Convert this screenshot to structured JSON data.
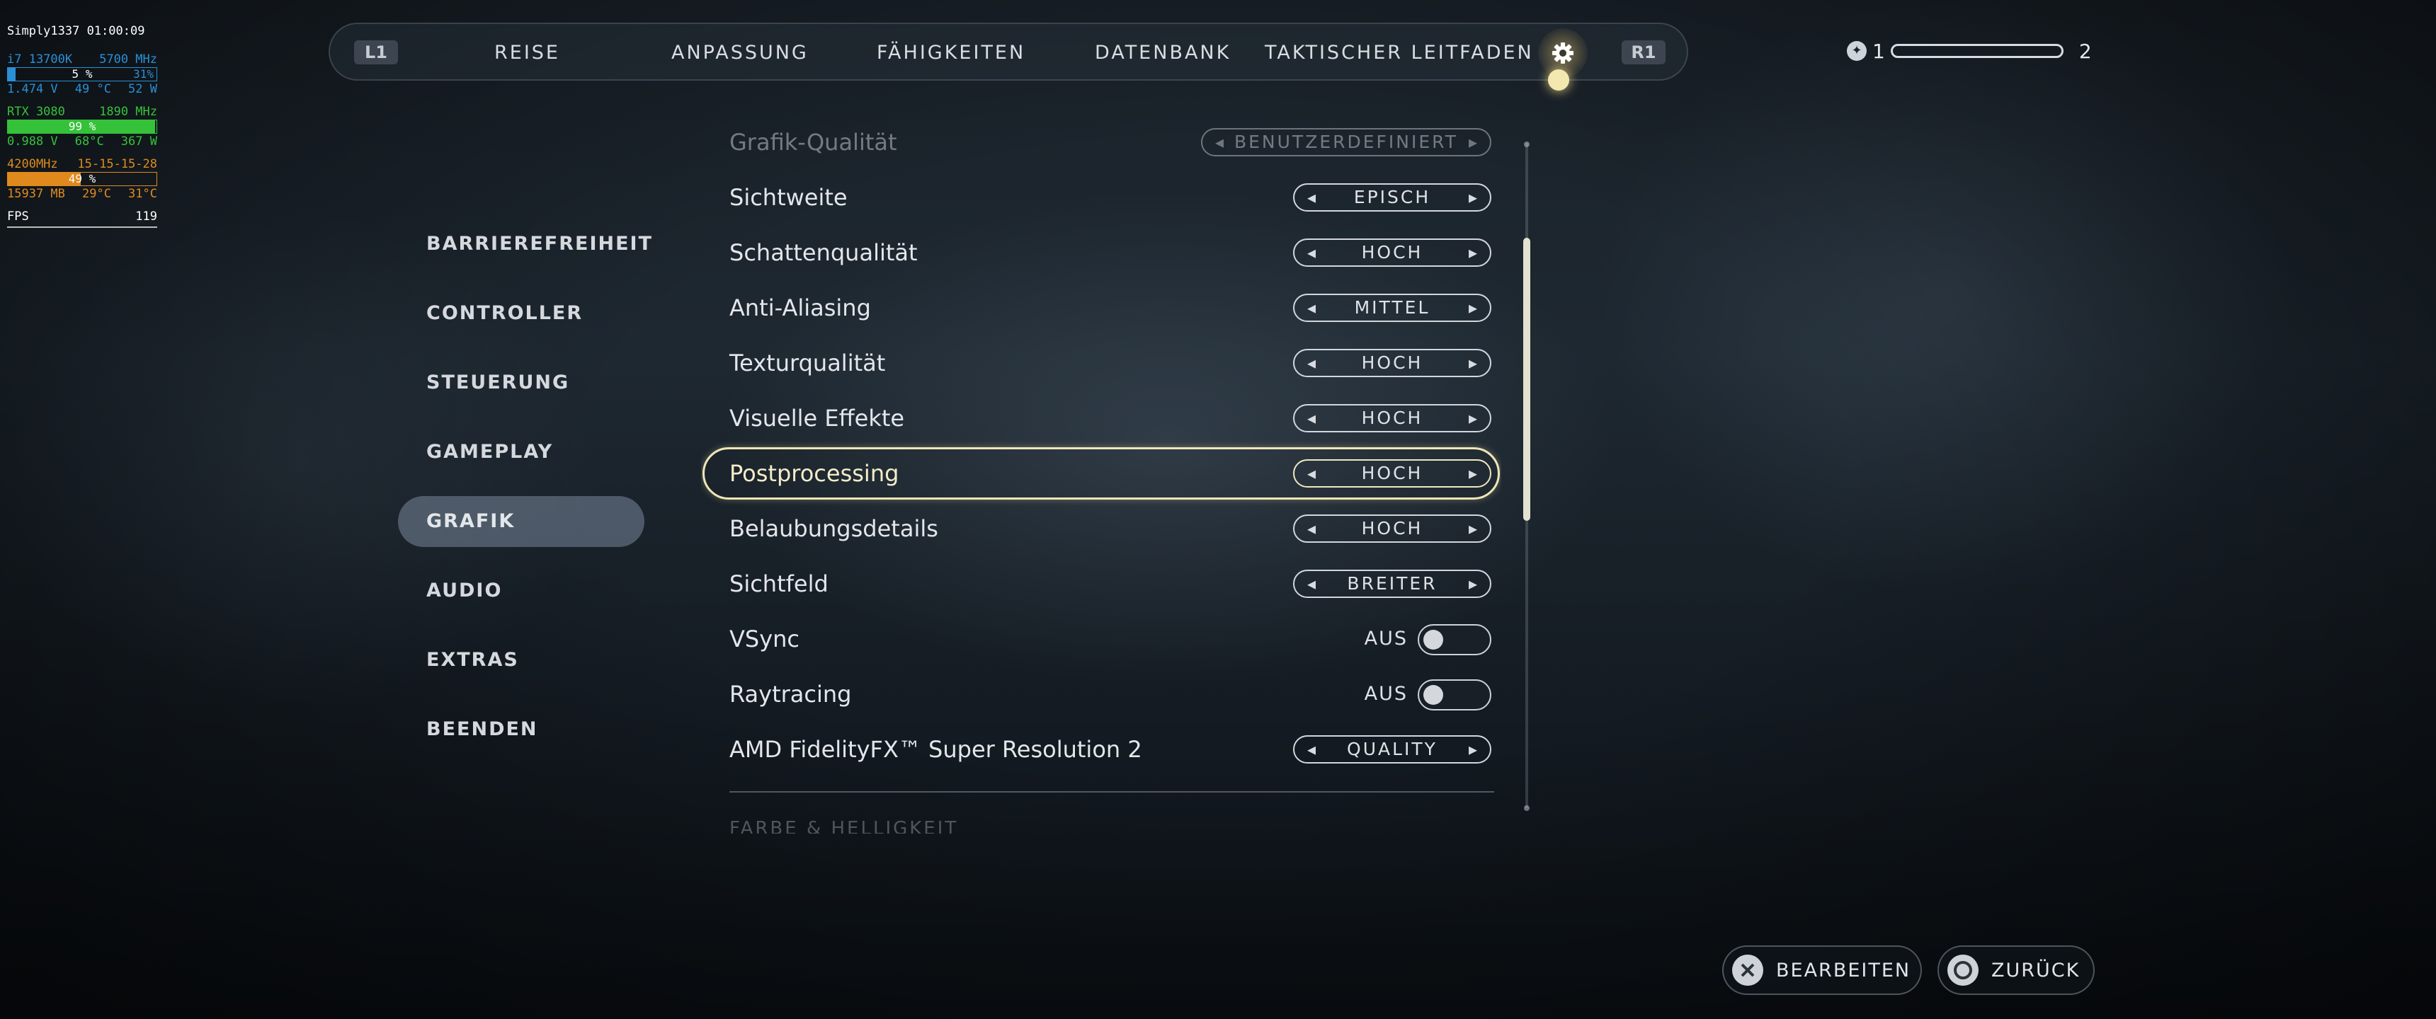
{
  "hud": {
    "user_time": "Simply1337 01:00:09",
    "cpu_name": "i7 13700K",
    "cpu_clock": "5700 MHz",
    "cpu_usage": "5 %",
    "cpu_usage_fraction": 0.05,
    "cpu_power_pct": "31%",
    "cpu_voltage": "1.474 V",
    "cpu_temp": "49 °C",
    "cpu_watts": "52 W",
    "gpu_name": "RTX 3080",
    "gpu_clock": "1890 MHz",
    "gpu_usage": "99 %",
    "gpu_usage_fraction": 0.99,
    "gpu_voltage": "0.988 V",
    "gpu_temp": "68°C",
    "gpu_watts": "367 W",
    "ram_speed": "4200MHz",
    "ram_timings": "15-15-15-28",
    "ram_usage": "49 %",
    "ram_usage_fraction": 0.49,
    "ram_size": "15937 MB",
    "ram_temp1": "29°C",
    "ram_temp2": "31°C",
    "fps_label": "FPS",
    "fps_value": "119"
  },
  "topnav": {
    "left_shoulder": "L1",
    "right_shoulder": "R1",
    "items": [
      "REISE",
      "ANPASSUNG",
      "FÄHIGKEITEN",
      "DATENBANK",
      "TAKTISCHER LEITFADEN"
    ],
    "active_icon": "gear-icon"
  },
  "level": {
    "current": "1",
    "next": "2",
    "progress_fraction": 0.0
  },
  "categories": [
    {
      "label": "BARRIEREFREIHEIT",
      "active": false
    },
    {
      "label": "CONTROLLER",
      "active": false
    },
    {
      "label": "STEUERUNG",
      "active": false
    },
    {
      "label": "GAMEPLAY",
      "active": false
    },
    {
      "label": "GRAFIK",
      "active": true
    },
    {
      "label": "AUDIO",
      "active": false
    },
    {
      "label": "EXTRAS",
      "active": false
    },
    {
      "label": "BEENDEN",
      "active": false
    }
  ],
  "settings": {
    "faded_top": {
      "label": "Grafik-Qualität",
      "value": "BENUTZERDEFINIERT"
    },
    "rows": [
      {
        "label": "Sichtweite",
        "value": "EPISCH"
      },
      {
        "label": "Schattenqualität",
        "value": "HOCH"
      },
      {
        "label": "Anti-Aliasing",
        "value": "MITTEL"
      },
      {
        "label": "Texturqualität",
        "value": "HOCH"
      },
      {
        "label": "Visuelle Effekte",
        "value": "HOCH"
      },
      {
        "label": "Postprocessing",
        "value": "HOCH",
        "selected": true
      },
      {
        "label": "Belaubungsdetails",
        "value": "HOCH"
      },
      {
        "label": "Sichtfeld",
        "value": "BREITER"
      }
    ],
    "toggles": [
      {
        "label": "VSync",
        "state": "AUS"
      },
      {
        "label": "Raytracing",
        "state": "AUS"
      }
    ],
    "fsr": {
      "label": "AMD FidelityFX™ Super Resolution 2",
      "value": "QUALITY"
    },
    "next_section": "FARBE & HELLIGKEIT"
  },
  "prompts": {
    "edit": "BEARBEITEN",
    "back": "ZURÜCK"
  },
  "colors": {
    "selection_outline": "#efe6b6",
    "hud_blue": "#2a8fd6",
    "hud_green": "#35c23a",
    "hud_orange": "#e08a1e"
  }
}
